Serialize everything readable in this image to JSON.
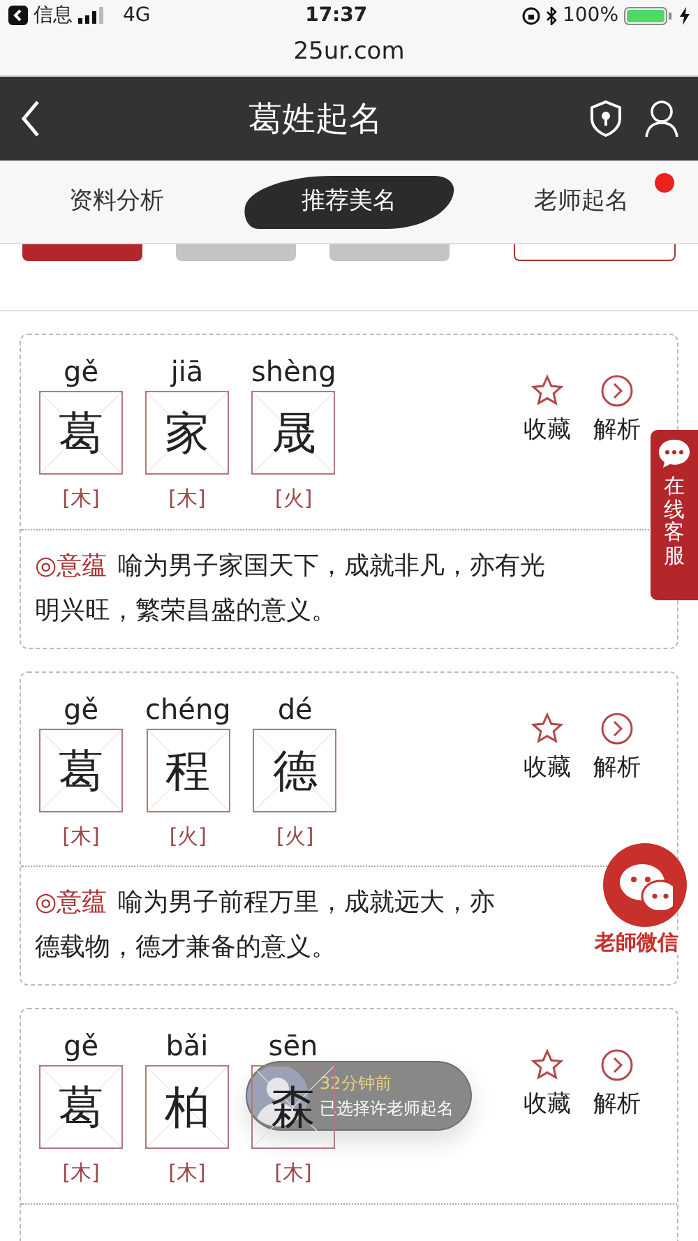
{
  "status_bar": {
    "back_app": "信息",
    "network": "4G",
    "time": "17:37",
    "battery": "100%"
  },
  "url_bar": {
    "url": "25ur.com"
  },
  "header": {
    "title": "葛姓起名"
  },
  "tabs": [
    {
      "label": "资料分析",
      "selected": false,
      "dot": false
    },
    {
      "label": "推荐美名",
      "selected": true,
      "dot": false
    },
    {
      "label": "老师起名",
      "selected": false,
      "dot": true
    }
  ],
  "names": [
    {
      "chars": [
        {
          "pinyin": "gě",
          "char": "葛",
          "element": "[木]"
        },
        {
          "pinyin": "jiā",
          "char": "家",
          "element": "[木]"
        },
        {
          "pinyin": "shèng",
          "char": "晟",
          "element": "[火]"
        }
      ],
      "favorite_label": "收藏",
      "analysis_label": "解析",
      "meaning_label": "◎意蕴",
      "meaning_lines": [
        "喻为男子家国天下，成就非凡，亦有光",
        "明兴旺，繁荣昌盛的意义。"
      ]
    },
    {
      "chars": [
        {
          "pinyin": "gě",
          "char": "葛",
          "element": "[木]"
        },
        {
          "pinyin": "chéng",
          "char": "程",
          "element": "[火]"
        },
        {
          "pinyin": "dé",
          "char": "德",
          "element": "[火]"
        }
      ],
      "favorite_label": "收藏",
      "analysis_label": "解析",
      "meaning_label": "◎意蕴",
      "meaning_lines": [
        "喻为男子前程万里，成就远大，亦",
        "德载物，德才兼备的意义。"
      ]
    },
    {
      "chars": [
        {
          "pinyin": "gě",
          "char": "葛",
          "element": "[木]"
        },
        {
          "pinyin": "bǎi",
          "char": "柏",
          "element": "[木]"
        },
        {
          "pinyin": "sēn",
          "char": "森",
          "element": "[木]"
        }
      ],
      "favorite_label": "收藏",
      "analysis_label": "解析"
    }
  ],
  "service_tab": {
    "label": "在线客服"
  },
  "wechat_float": {
    "label": "老師微信"
  },
  "toast": {
    "time": "32分钟前",
    "message": "已选择许老师起名"
  }
}
